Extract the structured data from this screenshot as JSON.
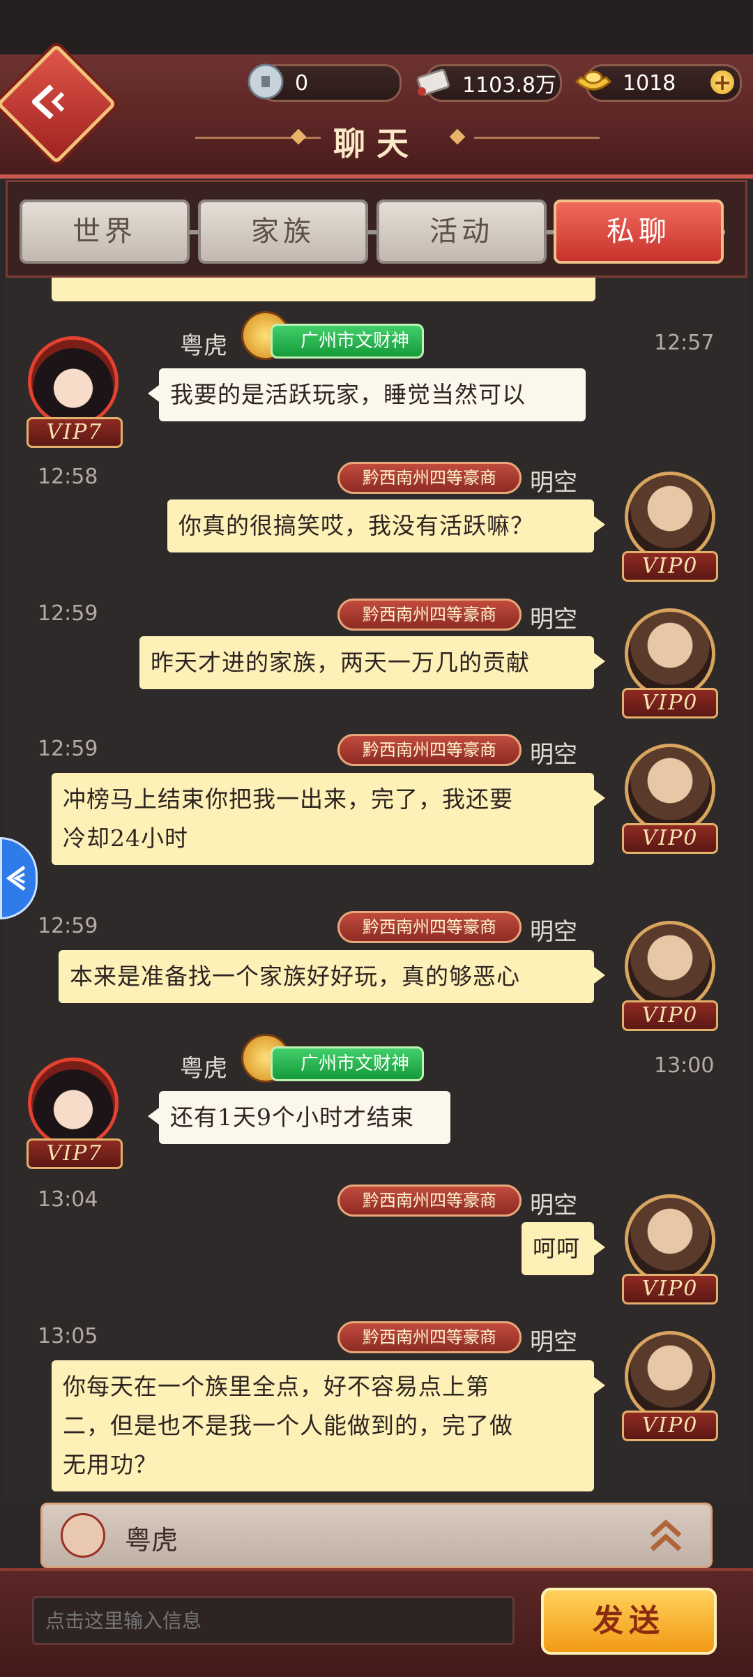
{
  "header": {
    "title": "聊天",
    "currencies": [
      {
        "icon": "silver-coin-icon",
        "value": "0"
      },
      {
        "icon": "scroll-icon",
        "value": "1103.8万"
      },
      {
        "icon": "gold-ingot-icon",
        "value": "1018"
      }
    ]
  },
  "tabs": [
    {
      "label": "世界",
      "active": false
    },
    {
      "label": "家族",
      "active": false
    },
    {
      "label": "活动",
      "active": false
    },
    {
      "label": "私聊",
      "active": true
    }
  ],
  "messages": [
    {
      "side": "left",
      "name": "粤虎",
      "title": "广州市文财神",
      "time": "12:57",
      "vip": "VIP7",
      "lines": [
        "我要的是活跃玩家，睡觉当然可以"
      ]
    },
    {
      "side": "right",
      "name": "明空",
      "rank": "黔西南州四等豪商",
      "time": "12:58",
      "vip": "VIP0",
      "lines": [
        "你真的很搞笑哎，我没有活跃嘛？"
      ]
    },
    {
      "side": "right",
      "name": "明空",
      "rank": "黔西南州四等豪商",
      "time": "12:59",
      "vip": "VIP0",
      "lines": [
        "昨天才进的家族，两天一万几的贡献"
      ]
    },
    {
      "side": "right",
      "name": "明空",
      "rank": "黔西南州四等豪商",
      "time": "12:59",
      "vip": "VIP0",
      "lines": [
        "冲榜马上结束你把我一出来，完了，我还要",
        "冷却24小时"
      ]
    },
    {
      "side": "right",
      "name": "明空",
      "rank": "黔西南州四等豪商",
      "time": "12:59",
      "vip": "VIP0",
      "lines": [
        "本来是准备找一个家族好好玩，真的够恶心"
      ]
    },
    {
      "side": "left",
      "name": "粤虎",
      "title": "广州市文财神",
      "time": "13:00",
      "vip": "VIP7",
      "lines": [
        "还有1天9个小时才结束"
      ]
    },
    {
      "side": "right",
      "name": "明空",
      "rank": "黔西南州四等豪商",
      "time": "13:04",
      "vip": "VIP0",
      "lines": [
        "呵呵"
      ]
    },
    {
      "side": "right",
      "name": "明空",
      "rank": "黔西南州四等豪商",
      "time": "13:05",
      "vip": "VIP0",
      "lines": [
        "你每天在一个族里全点，好不容易点上第",
        "二，但是也不是我一个人能做到的，完了做",
        "无用功？"
      ]
    }
  ],
  "target": {
    "name": "粤虎"
  },
  "input": {
    "placeholder": "点击这里输入信息",
    "send_label": "发送"
  }
}
